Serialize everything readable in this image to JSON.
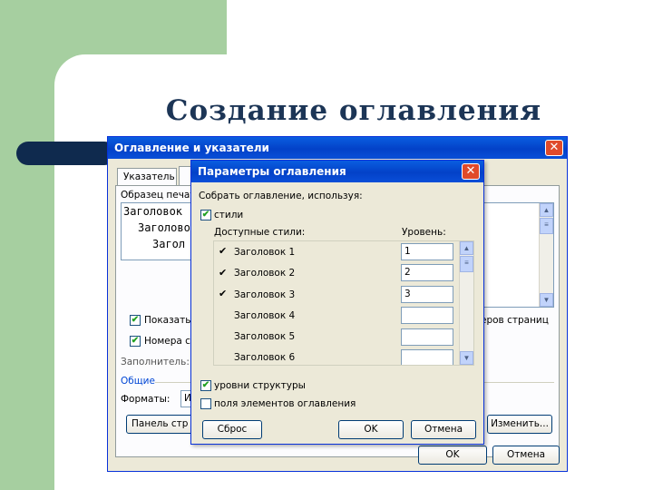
{
  "slide": {
    "title": "Создание оглавления"
  },
  "outer_dialog": {
    "title": "Оглавление и указатели",
    "tab_index_label": "Указатель",
    "preview_label": "Образец печат",
    "preview_lines": [
      "Заголовок",
      "Заголово",
      "Загол"
    ],
    "show_label": "Показать н",
    "numbers_label": "Номера стр",
    "right_numbers_tail": "еров страниц",
    "filler_label": "Заполнитель:",
    "general_label": "Общие",
    "formats_label": "Форматы:",
    "formats_value": "И",
    "panel_button": "Панель стр",
    "modify_button": "Изменить...",
    "ok_button": "OK",
    "cancel_button": "Отмена"
  },
  "inner_dialog": {
    "title": "Параметры оглавления",
    "collect_label": "Собрать оглавление, используя:",
    "styles_checkbox": "стили",
    "available_styles_header": "Доступные стили:",
    "level_header": "Уровень:",
    "rows": [
      {
        "style": "Заголовок 1",
        "level": "1",
        "checked": true
      },
      {
        "style": "Заголовок 2",
        "level": "2",
        "checked": true
      },
      {
        "style": "Заголовок 3",
        "level": "3",
        "checked": true
      },
      {
        "style": "Заголовок 4",
        "level": "",
        "checked": false
      },
      {
        "style": "Заголовок 5",
        "level": "",
        "checked": false
      },
      {
        "style": "Заголовок 6",
        "level": "",
        "checked": false
      }
    ],
    "outline_checkbox": "уровни структуры",
    "fields_checkbox": "поля элементов оглавления",
    "reset_button": "Сброс",
    "ok_button": "OK",
    "cancel_button": "Отмена"
  }
}
